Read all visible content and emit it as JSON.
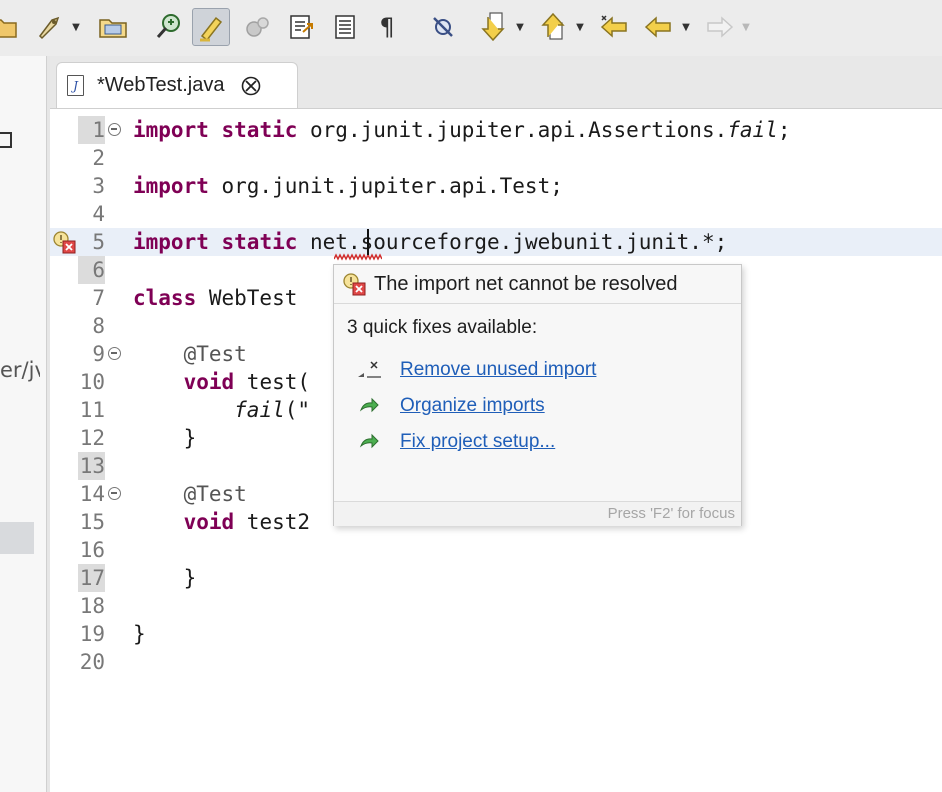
{
  "toolbar": {
    "buttons": [
      {
        "icon": "open-folder-icon"
      },
      {
        "icon": "run-launcher-icon"
      },
      {
        "icon": "open-type-icon"
      },
      {
        "icon": "debug-search-icon"
      },
      {
        "icon": "highlighter-icon",
        "pressed": true
      },
      {
        "icon": "gear-cluster-icon"
      },
      {
        "icon": "external-doc-icon"
      },
      {
        "icon": "block-selection-icon"
      },
      {
        "icon": "pilcrow-icon"
      },
      {
        "icon": "breakpoint-skip-icon"
      },
      {
        "icon": "next-annotation-icon"
      },
      {
        "icon": "previous-annotation-icon"
      },
      {
        "icon": "last-edit-icon"
      },
      {
        "icon": "back-arrow-icon"
      },
      {
        "icon": "forward-arrow-icon"
      }
    ],
    "pilcrow": "¶"
  },
  "left_panel": {
    "fragment": "er/jv"
  },
  "editor": {
    "tab": {
      "title": "*WebTest.java",
      "file_icon_letter": "J"
    },
    "lines": [
      {
        "num": "1",
        "num_marked": true,
        "fold": true,
        "tokens": [
          {
            "t": "import",
            "kw": true
          },
          {
            "t": " "
          },
          {
            "t": "static",
            "kw": true
          },
          {
            "t": " org.junit.jupiter.api.Assertions."
          },
          {
            "t": "fail",
            "it": true
          },
          {
            "t": ";"
          }
        ]
      },
      {
        "num": "2",
        "tokens": []
      },
      {
        "num": "3",
        "tokens": [
          {
            "t": "import",
            "kw": true
          },
          {
            "t": " org.junit.jupiter.api.Test;"
          }
        ]
      },
      {
        "num": "4",
        "tokens": []
      },
      {
        "num": "5",
        "current": true,
        "error": true,
        "tokens": [
          {
            "t": "import",
            "kw": true
          },
          {
            "t": " "
          },
          {
            "t": "static",
            "kw": true
          },
          {
            "t": " net.sourceforge.jwebunit.junit.*;"
          }
        ]
      },
      {
        "num": "6",
        "num_marked": true,
        "tokens": []
      },
      {
        "num": "7",
        "tokens": [
          {
            "t": "class",
            "kw": true
          },
          {
            "t": " WebTest"
          }
        ]
      },
      {
        "num": "8",
        "tokens": []
      },
      {
        "num": "9",
        "fold": true,
        "tokens": [
          {
            "t": "    "
          },
          {
            "t": "@Test",
            "anno": true
          }
        ]
      },
      {
        "num": "10",
        "tokens": [
          {
            "t": "    "
          },
          {
            "t": "void",
            "kw": true
          },
          {
            "t": " test("
          }
        ]
      },
      {
        "num": "11",
        "tokens": [
          {
            "t": "        "
          },
          {
            "t": "fail",
            "it": true
          },
          {
            "t": "(\""
          }
        ]
      },
      {
        "num": "12",
        "tokens": [
          {
            "t": "    }"
          }
        ]
      },
      {
        "num": "13",
        "num_marked": true,
        "tokens": []
      },
      {
        "num": "14",
        "fold": true,
        "tokens": [
          {
            "t": "    "
          },
          {
            "t": "@Test",
            "anno": true
          }
        ]
      },
      {
        "num": "15",
        "tokens": [
          {
            "t": "    "
          },
          {
            "t": "void",
            "kw": true
          },
          {
            "t": " test2"
          }
        ]
      },
      {
        "num": "16",
        "tokens": []
      },
      {
        "num": "17",
        "num_marked": true,
        "tokens": [
          {
            "t": "    }"
          }
        ]
      },
      {
        "num": "18",
        "tokens": []
      },
      {
        "num": "19",
        "tokens": [
          {
            "t": "}"
          }
        ]
      },
      {
        "num": "20",
        "tokens": []
      }
    ]
  },
  "popup": {
    "title": "The import net cannot be resolved",
    "subtitle": "3 quick fixes available:",
    "fixes": [
      {
        "label": "Remove unused import",
        "icon": "remove-import-icon"
      },
      {
        "label": "Organize imports",
        "icon": "green-arrow-icon"
      },
      {
        "label": "Fix project setup...",
        "icon": "green-arrow-icon"
      }
    ],
    "footer": "Press 'F2' for focus"
  },
  "colors": {
    "keyword": "#7f0055",
    "link": "#1f5eb8",
    "current_line": "#e9eff8",
    "error_red": "#d03030"
  }
}
